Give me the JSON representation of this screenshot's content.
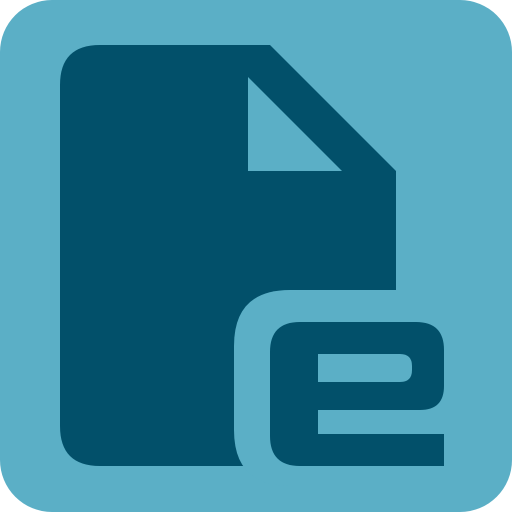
{
  "app_icon": {
    "icon_name": "document-e-icon",
    "colors": {
      "tile_background": "#5bafc6",
      "document_fill": "#02506a",
      "document_fold": "#5bafc6",
      "letter_e_fill": "#02506a",
      "letter_e_outline": "#5bafc6"
    }
  }
}
